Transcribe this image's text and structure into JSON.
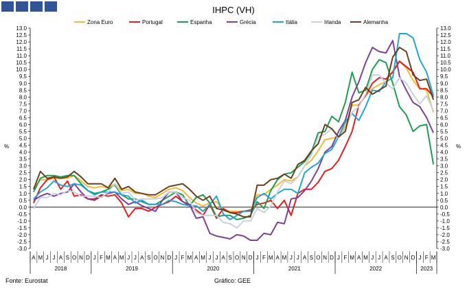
{
  "footer": {
    "source": "Fonte: Eurostat",
    "credit": "Gráfico: GEE"
  },
  "chart_data": {
    "type": "line",
    "title": "IHPC (VH)",
    "ylabel": "%",
    "ylim": [
      -3.0,
      13.0
    ],
    "ystep": 0.5,
    "grid": false,
    "legend_position": "top",
    "x": [
      "2018-04",
      "2018-05",
      "2018-06",
      "2018-07",
      "2018-08",
      "2018-09",
      "2018-10",
      "2018-11",
      "2018-12",
      "2019-01",
      "2019-02",
      "2019-03",
      "2019-04",
      "2019-05",
      "2019-06",
      "2019-07",
      "2019-08",
      "2019-09",
      "2019-10",
      "2019-11",
      "2019-12",
      "2020-01",
      "2020-02",
      "2020-03",
      "2020-04",
      "2020-05",
      "2020-06",
      "2020-07",
      "2020-08",
      "2020-09",
      "2020-10",
      "2020-11",
      "2020-12",
      "2021-01",
      "2021-02",
      "2021-03",
      "2021-04",
      "2021-05",
      "2021-06",
      "2021-07",
      "2021-08",
      "2021-09",
      "2021-10",
      "2021-11",
      "2021-12",
      "2022-01",
      "2022-02",
      "2022-03",
      "2022-04",
      "2022-05",
      "2022-06",
      "2022-07",
      "2022-08",
      "2022-09",
      "2022-10",
      "2022-11",
      "2022-12",
      "2023-01",
      "2023-02",
      "2023-03"
    ],
    "month_labels": [
      "A",
      "M",
      "J",
      "J",
      "A",
      "S",
      "O",
      "N",
      "D",
      "J",
      "F",
      "M",
      "A",
      "M",
      "J",
      "J",
      "A",
      "S",
      "O",
      "N",
      "D",
      "J",
      "F",
      "M",
      "A",
      "M",
      "J",
      "J",
      "A",
      "S",
      "O",
      "N",
      "D",
      "J",
      "F",
      "M",
      "A",
      "M",
      "J",
      "J",
      "A",
      "S",
      "O",
      "N",
      "D",
      "J",
      "F",
      "M",
      "A",
      "M",
      "J",
      "J",
      "A",
      "S",
      "O",
      "N",
      "D",
      "J",
      "F",
      "M"
    ],
    "year_labels": [
      {
        "label": "2018",
        "start": 0,
        "end": 8
      },
      {
        "label": "2019",
        "start": 9,
        "end": 20
      },
      {
        "label": "2020",
        "start": 21,
        "end": 32
      },
      {
        "label": "2021",
        "start": 33,
        "end": 44
      },
      {
        "label": "2022",
        "start": 45,
        "end": 56
      },
      {
        "label": "2023",
        "start": 57,
        "end": 59
      }
    ],
    "series": [
      {
        "name": "Zona Euro",
        "color": "#f2b933",
        "values": [
          1.3,
          2.0,
          2.0,
          2.1,
          2.1,
          2.1,
          2.3,
          1.9,
          1.5,
          1.4,
          1.5,
          1.4,
          1.7,
          1.2,
          1.3,
          1.0,
          1.0,
          0.8,
          0.7,
          1.0,
          1.3,
          1.4,
          1.2,
          0.7,
          0.3,
          0.1,
          0.3,
          0.4,
          -0.2,
          -0.3,
          -0.3,
          -0.3,
          -0.3,
          0.9,
          0.9,
          1.3,
          1.6,
          2.0,
          1.9,
          2.2,
          3.0,
          3.4,
          4.1,
          4.9,
          5.0,
          5.1,
          5.9,
          7.4,
          7.4,
          8.1,
          8.6,
          8.9,
          9.1,
          9.9,
          10.6,
          10.1,
          9.2,
          8.6,
          8.5,
          6.9
        ]
      },
      {
        "name": "Portugal",
        "color": "#e41d1d",
        "values": [
          0.3,
          1.4,
          2.0,
          2.2,
          1.3,
          1.9,
          0.8,
          0.9,
          0.6,
          0.6,
          0.9,
          0.8,
          0.9,
          0.3,
          -0.7,
          -0.1,
          -0.1,
          -0.3,
          0.0,
          0.2,
          0.4,
          0.8,
          0.4,
          0.1,
          -0.2,
          -0.6,
          0.2,
          -0.8,
          -0.1,
          -0.4,
          -0.4,
          -0.3,
          -0.2,
          0.2,
          0.3,
          0.5,
          -0.1,
          0.5,
          -0.6,
          1.0,
          1.3,
          1.3,
          1.8,
          2.6,
          2.8,
          3.4,
          4.4,
          5.5,
          7.4,
          8.1,
          9.0,
          9.4,
          9.3,
          9.8,
          10.6,
          10.2,
          9.8,
          8.6,
          8.6,
          8.0
        ]
      },
      {
        "name": "Espanha",
        "color": "#1d9e4e",
        "values": [
          1.1,
          2.1,
          2.3,
          2.3,
          2.2,
          2.3,
          2.3,
          1.7,
          1.2,
          1.0,
          1.1,
          1.3,
          1.6,
          0.9,
          0.6,
          0.6,
          0.4,
          0.2,
          0.2,
          0.5,
          0.8,
          1.1,
          0.9,
          0.1,
          0.7,
          0.9,
          0.3,
          -0.7,
          -0.6,
          -0.6,
          -0.9,
          -0.8,
          -0.6,
          0.4,
          -0.1,
          1.2,
          2.0,
          2.4,
          2.5,
          2.9,
          3.3,
          4.0,
          5.4,
          5.5,
          6.6,
          6.2,
          7.6,
          9.8,
          8.3,
          8.5,
          10.0,
          10.7,
          10.5,
          9.0,
          7.3,
          6.7,
          5.5,
          5.9,
          6.0,
          3.1
        ]
      },
      {
        "name": "Grécia",
        "color": "#7d3f98",
        "values": [
          0.5,
          0.8,
          1.0,
          0.8,
          1.0,
          1.1,
          1.7,
          1.1,
          0.6,
          0.5,
          0.8,
          1.0,
          1.1,
          0.6,
          0.2,
          0.4,
          0.1,
          -0.1,
          -0.3,
          0.5,
          1.1,
          1.1,
          0.4,
          0.2,
          -0.8,
          -0.7,
          -1.9,
          -2.1,
          -2.2,
          -2.3,
          -2.0,
          -2.1,
          -2.4,
          -2.4,
          -1.9,
          -2.0,
          -1.1,
          -1.2,
          0.6,
          0.7,
          1.2,
          1.9,
          2.8,
          4.0,
          4.4,
          5.5,
          6.3,
          8.0,
          9.1,
          10.5,
          11.6,
          11.3,
          11.2,
          12.1,
          9.5,
          8.5,
          7.6,
          7.3,
          6.5,
          5.4
        ]
      },
      {
        "name": "Itália",
        "color": "#20a4d8",
        "values": [
          0.6,
          1.1,
          1.4,
          1.9,
          1.6,
          1.5,
          1.7,
          1.6,
          1.2,
          0.9,
          1.1,
          1.1,
          1.1,
          0.9,
          0.8,
          0.3,
          0.5,
          0.2,
          0.2,
          0.2,
          0.5,
          0.4,
          0.2,
          0.1,
          0.1,
          -0.3,
          0.2,
          0.8,
          -0.5,
          -0.9,
          -0.6,
          -0.3,
          -0.3,
          0.7,
          1.0,
          0.6,
          1.0,
          1.3,
          1.3,
          1.0,
          2.5,
          2.9,
          3.2,
          3.9,
          4.2,
          5.1,
          6.2,
          6.8,
          6.3,
          7.3,
          8.5,
          8.4,
          9.1,
          9.4,
          12.6,
          12.6,
          12.3,
          10.7,
          9.8,
          8.1
        ]
      },
      {
        "name": "Irlanda",
        "color": "#c9d1e0",
        "values": [
          -0.1,
          0.7,
          0.7,
          1.0,
          0.9,
          1.2,
          1.1,
          0.8,
          0.8,
          0.8,
          0.7,
          1.1,
          1.7,
          1.0,
          1.1,
          0.5,
          0.6,
          0.6,
          0.6,
          0.7,
          1.1,
          1.1,
          0.7,
          0.5,
          -0.4,
          -0.6,
          -0.6,
          -0.6,
          -1.1,
          -1.2,
          -1.5,
          -1.0,
          -1.0,
          -0.1,
          -0.4,
          0.1,
          1.1,
          1.9,
          1.7,
          2.2,
          3.0,
          3.8,
          5.1,
          5.3,
          5.7,
          5.0,
          5.7,
          6.9,
          7.3,
          8.2,
          9.6,
          9.6,
          9.0,
          8.6,
          9.4,
          9.0,
          8.2,
          7.5,
          8.1,
          7.0
        ]
      },
      {
        "name": "Alemanha",
        "color": "#6b3e1d",
        "values": [
          1.3,
          2.6,
          2.1,
          2.2,
          2.1,
          2.2,
          2.6,
          2.2,
          1.7,
          1.7,
          1.7,
          1.4,
          2.1,
          1.3,
          1.5,
          1.1,
          1.0,
          0.9,
          0.9,
          1.2,
          1.5,
          1.6,
          1.7,
          1.3,
          0.8,
          0.5,
          0.8,
          -0.1,
          -0.2,
          -0.4,
          -0.5,
          -0.7,
          -0.7,
          1.6,
          1.6,
          2.0,
          2.1,
          2.4,
          2.1,
          3.1,
          3.4,
          4.1,
          4.6,
          6.0,
          5.7,
          5.1,
          5.5,
          7.6,
          7.8,
          8.7,
          8.2,
          8.5,
          8.8,
          10.9,
          11.6,
          11.3,
          9.6,
          9.2,
          9.3,
          7.8
        ]
      }
    ]
  }
}
